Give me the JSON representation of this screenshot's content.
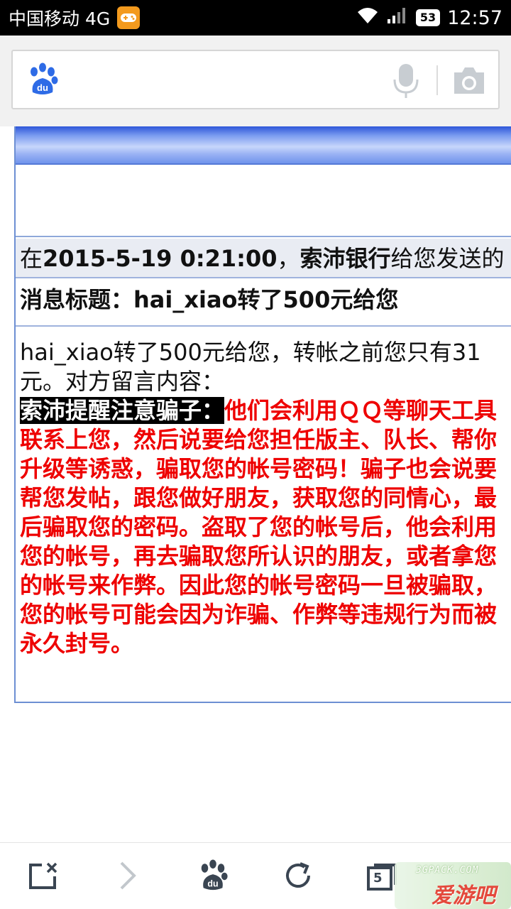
{
  "status_bar": {
    "carrier": "中国移动 4G",
    "battery": "53",
    "time": "12:57"
  },
  "search": {
    "placeholder": ""
  },
  "message_page": {
    "notice": {
      "prefix": "在",
      "datetime": "2015-5-19 0:21:00",
      "comma": "，",
      "sender": "索沛银行",
      "suffix": "给您发送的"
    },
    "subject": "消息标题：hai_xiao转了500元给您",
    "body": "hai_xiao转了500元给您，转帐之前您只有31元。对方留言内容：",
    "warning_title": "索沛提醒注意骗子：",
    "warning_text": "他们会利用ＱＱ等聊天工具联系上您，然后说要给您担任版主、队长、帮你升级等诱惑，骗取您的帐号密码！骗子也会说要帮您发帖，跟您做好朋友，获取您的同情心，最后骗取您的密码。盗取了您的帐号后，他会利用您的帐号，再去骗取您所认识的朋友，或者拿您的帐号来作弊。因此您的帐号密码一旦被骗取，您的帐号可能会因为诈骗、作弊等违规行为而被永久封号。"
  },
  "toolbar": {
    "tabs_count": "5"
  },
  "watermark": {
    "url": "3GPACK.COM",
    "name": "爱游吧"
  },
  "colors": {
    "warning": "#ee0000",
    "header_blue": "#2d56d9",
    "baidu_blue": "#2e6be6"
  }
}
